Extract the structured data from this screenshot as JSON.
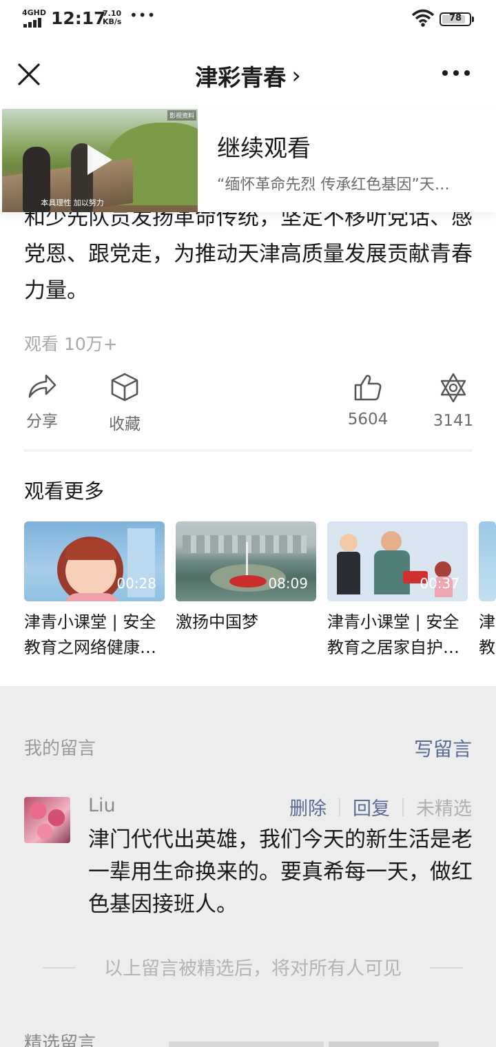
{
  "status_bar": {
    "network": "4GHD",
    "time": "12:17",
    "speed_value": "7.10",
    "speed_unit": "KB/s",
    "dots": "•••",
    "battery": "78"
  },
  "nav": {
    "title": "津彩青春",
    "title_chevron": "›"
  },
  "continue_watching": {
    "label": "继续观看",
    "video_title": "“缅怀革命先烈 传承红色基因”天…",
    "thumb_caption": "本具理性 加以努力",
    "thumb_tag": "影视资料"
  },
  "article": {
    "text": "和少先队员发扬革命传统，坚定不移听党话、感党恩、跟党走，为推动天津高质量发展贡献青春力量。",
    "views": "观看 10万+"
  },
  "actions": {
    "share": "分享",
    "favorite": "收藏",
    "like_count": "5604",
    "wow_count": "3141"
  },
  "more": {
    "title": "观看更多",
    "items": [
      {
        "duration": "00:28",
        "title": "津青小课堂 | 安全教育之网络健康…"
      },
      {
        "duration": "08:09",
        "title": "激扬中国梦"
      },
      {
        "duration": "00:37",
        "title": "津青小课堂 | 安全教育之居家自护…"
      },
      {
        "duration": "",
        "title": "津教"
      }
    ]
  },
  "comments": {
    "my_label": "我的留言",
    "write_label": "写留言",
    "author": "Liu",
    "delete": "删除",
    "reply": "回复",
    "status": "未精选",
    "body": "津门代代出英雄，我们今天的新生活是老一辈用生命换来的。要真希每一天，做红色基因接班人。",
    "notice": "以上留言被精选后，将对所有人可见",
    "selected_label": "精选留言"
  }
}
